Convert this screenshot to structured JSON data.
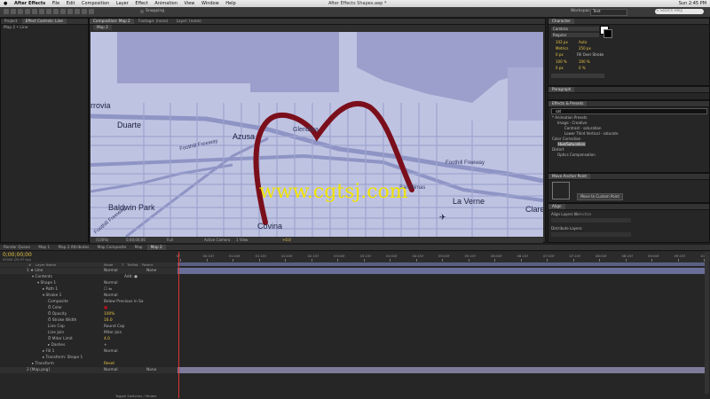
{
  "menubar": {
    "apple": "",
    "items": [
      "After Effects",
      "File",
      "Edit",
      "Composition",
      "Layer",
      "Effect",
      "Animation",
      "View",
      "Window",
      "Help"
    ],
    "title": "After Effects Shapes.aep *",
    "clock": "Sun 2:45 PM"
  },
  "toolbar": {
    "snapping": "Snapping",
    "workspace_label": "Workspace:",
    "workspace_value": "Text",
    "search_placeholder": "Search Help"
  },
  "project_panel": {
    "tabs": [
      "Project",
      "Effect Controls: Line"
    ],
    "item": "Map 2 • Line"
  },
  "comp_panel": {
    "tabs": [
      "Composition: Map 2",
      "Footage: (none)",
      "Layer: (none)"
    ],
    "comp_tab": "Map 2",
    "zoom": "(100%)",
    "timecode": "0;00;00;00",
    "resolution": "Full",
    "camera": "Active Camera",
    "views": "1 View",
    "exposure": "+0.0"
  },
  "map": {
    "labels": [
      "rrovia",
      "Duarte",
      "Azusa",
      "Glendora",
      "Foothill Freeway",
      "Foothill Freeway",
      "San Dimas",
      "La Verne",
      "Baldwin Park",
      "Covina",
      "Claremont",
      "Foothill Freeway"
    ],
    "watermark": "www.cgtsj.com"
  },
  "right": {
    "character_title": "Character",
    "font": "Cambria",
    "style": "Regular",
    "size": "102 px",
    "leading": "Auto",
    "metrics": "Metrics",
    "tracking": "250 px",
    "px_stroke": "0 px",
    "stroke_mode": "Fill Over Stroke",
    "vscale": "100 %",
    "hscale": "100 %",
    "baseline": "0 px",
    "tsume": "0 %",
    "paragraph_title": "Paragraph",
    "effects_title": "Effects & Presets",
    "effects_search": "sat",
    "effects_tree": [
      "* Animation Presets",
      "Image - Creative",
      "Contrast - saturation",
      "Lower Third Vertical - saturate",
      "Color Correction",
      "Hue/Saturation",
      "Distort",
      "Optics Compensation"
    ],
    "move_anchor_title": "Move Anchor Point",
    "move_anchor_button": "Move to Custom Point",
    "align_title": "Align",
    "align_layers": "Align Layers to:",
    "align_layers_value": "Selection",
    "distribute": "Distribute Layers:"
  },
  "timeline": {
    "tabs": [
      "Render Queue",
      "Map 1",
      "Map 2 Attributes",
      "Map Composite",
      "Map",
      "Map 2"
    ],
    "timecode": "0;00;00;00",
    "fps": "00000 (29.97 fps)",
    "columns": [
      "#",
      "Layer Name",
      "Mode",
      "T",
      "TrkMat",
      "Parent"
    ],
    "rows": [
      {
        "indent": 0,
        "name": "1  ★ Line",
        "value": "Normal",
        "parent": "None"
      },
      {
        "indent": 1,
        "name": "▾ Contents",
        "value": "Add: ●",
        "parent": ""
      },
      {
        "indent": 2,
        "name": "▾ Shape 1",
        "value": "Normal",
        "parent": ""
      },
      {
        "indent": 3,
        "name": "▸ Path 1",
        "value": "☐ ⇆",
        "parent": ""
      },
      {
        "indent": 3,
        "name": "▾ Stroke 1",
        "value": "Normal",
        "parent": ""
      },
      {
        "indent": 4,
        "name": "Composite",
        "value": "Below Previous in Sa",
        "parent": ""
      },
      {
        "indent": 4,
        "name": "Ö Color",
        "value": "■",
        "parent": ""
      },
      {
        "indent": 4,
        "name": "Ö Opacity",
        "value": "100%",
        "parent": ""
      },
      {
        "indent": 4,
        "name": "Ö Stroke Width",
        "value": "16.0",
        "parent": ""
      },
      {
        "indent": 4,
        "name": "Line Cap",
        "value": "Round Cap",
        "parent": ""
      },
      {
        "indent": 4,
        "name": "Line Join",
        "value": "Miter Join",
        "parent": ""
      },
      {
        "indent": 4,
        "name": "Ö Miter Limit",
        "value": "4.0",
        "parent": ""
      },
      {
        "indent": 4,
        "name": "▸ Dashes",
        "value": "+",
        "parent": ""
      },
      {
        "indent": 3,
        "name": "▸ Fill 1",
        "value": "Normal",
        "parent": ""
      },
      {
        "indent": 3,
        "name": "▸ Transform: Shape 1",
        "value": "",
        "parent": ""
      },
      {
        "indent": 1,
        "name": "▸ Transform",
        "value": "Reset",
        "parent": ""
      },
      {
        "indent": 0,
        "name": "2  [Map.png]",
        "value": "Normal",
        "parent": "None"
      }
    ],
    "ruler": [
      "0f",
      "00:15f",
      "01:00f",
      "01:15f",
      "02:00f",
      "02:15f",
      "03:00f",
      "03:15f",
      "04:00f",
      "04:15f",
      "05:00f",
      "05:15f",
      "06:00f",
      "06:15f",
      "07:00f",
      "07:15f",
      "08:00f",
      "08:15f",
      "09:00f",
      "09:15f",
      "10:0"
    ],
    "footer": "Toggle Switches / Modes"
  },
  "colors": {
    "map_bg": "#bfc3e2",
    "road": "#8e94c4",
    "stroke": "#7a0f1b",
    "accent_blue": "#3d5fa8",
    "watermark": "#f2e400"
  }
}
